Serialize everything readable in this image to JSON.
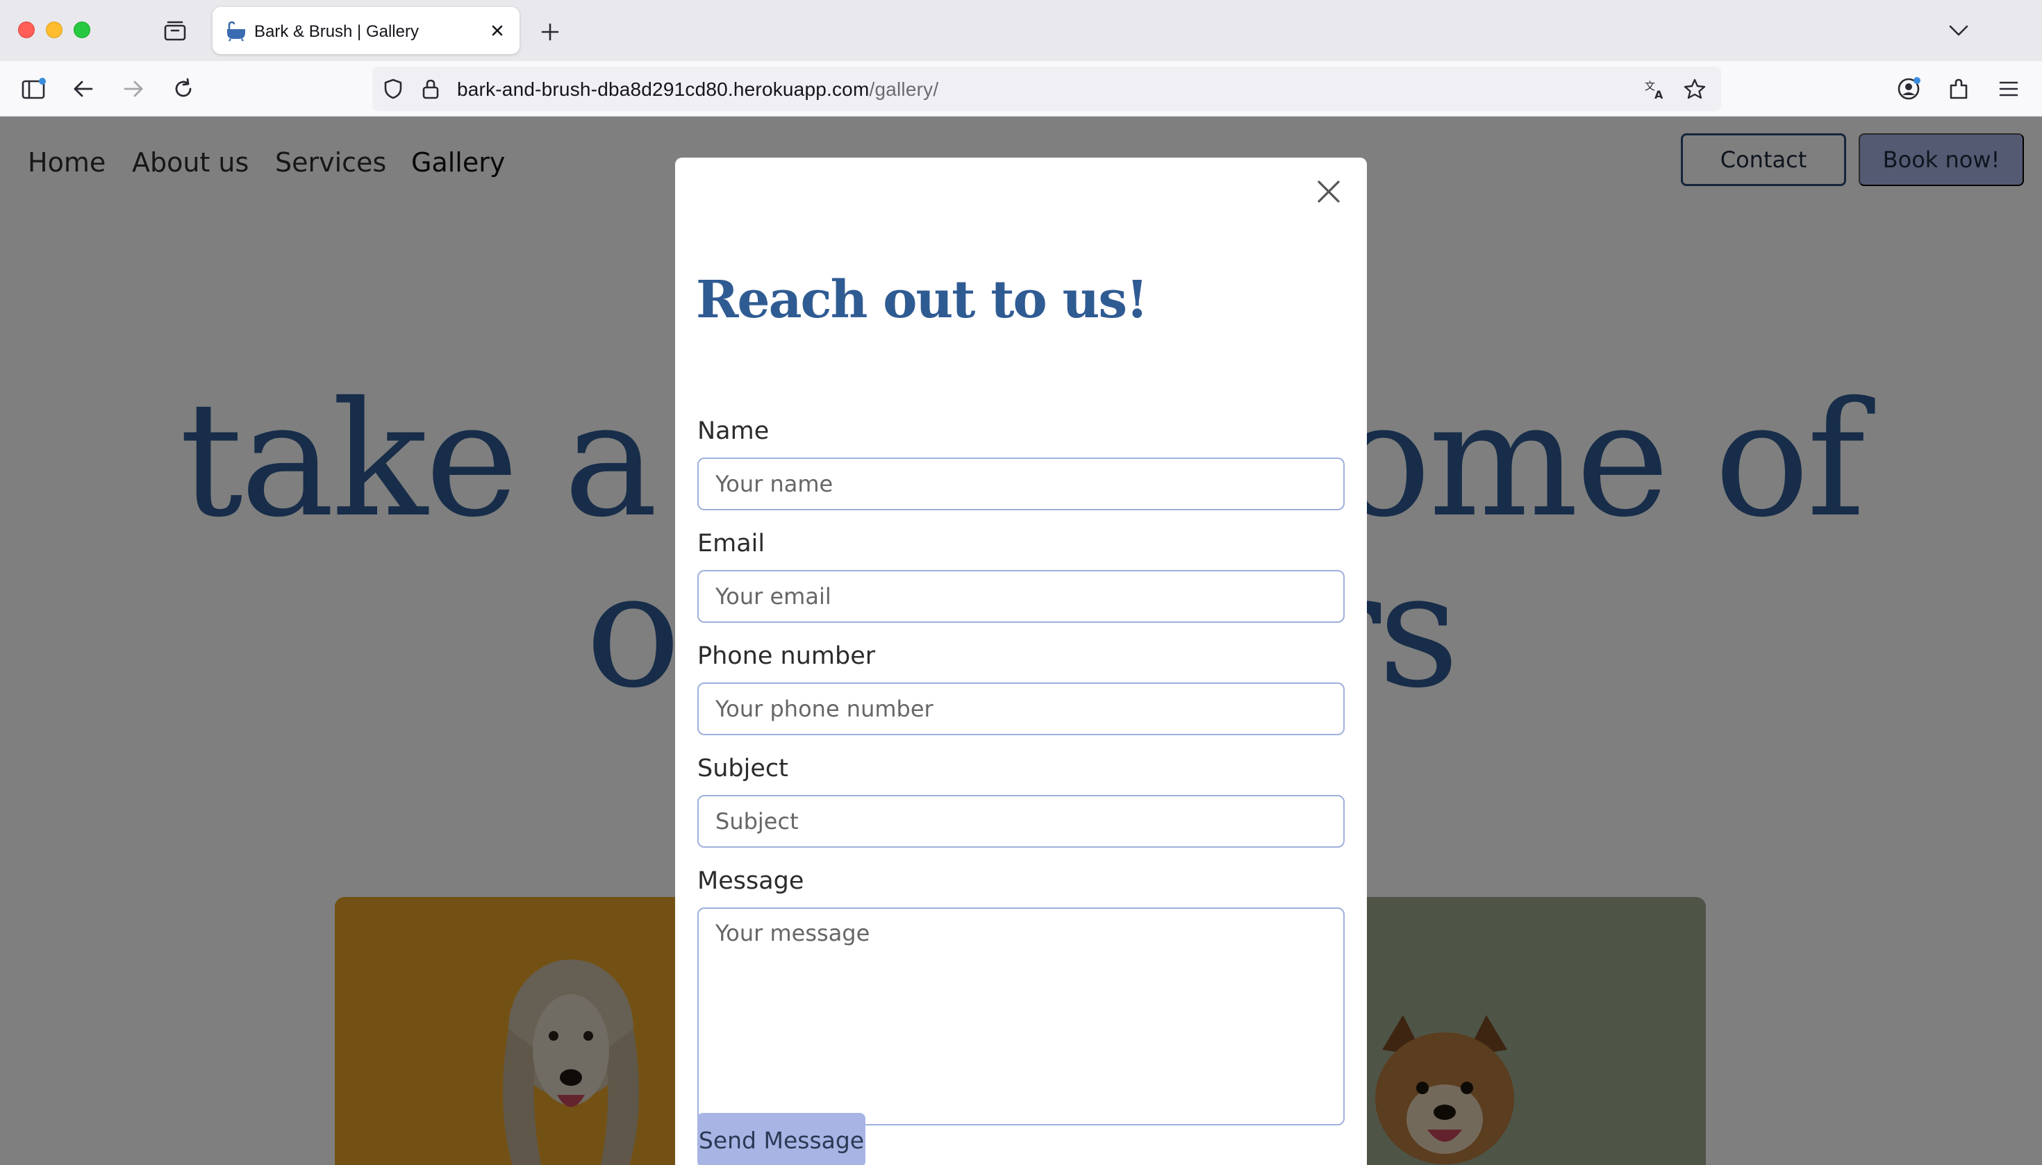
{
  "browser": {
    "tab_title": "Bark & Brush | Gallery",
    "url_host": "bark-and-brush-dba8d291cd80.herokuapp.com",
    "url_path": "/gallery/"
  },
  "site_nav": {
    "items": [
      "Home",
      "About us",
      "Services",
      "Gallery"
    ],
    "contact_label": "Contact",
    "book_label": "Book now!"
  },
  "hero": {
    "line1_left": "take a",
    "line1_right": "ome of",
    "line2_left": "ou",
    "line2_right": "rs"
  },
  "modal": {
    "title": "Reach out to us!",
    "fields": {
      "name": {
        "label": "Name",
        "placeholder": "Your name"
      },
      "email": {
        "label": "Email",
        "placeholder": "Your email"
      },
      "phone": {
        "label": "Phone number",
        "placeholder": "Your phone number"
      },
      "subject": {
        "label": "Subject",
        "placeholder": "Subject"
      },
      "message": {
        "label": "Message",
        "placeholder": "Your message"
      }
    },
    "submit_label": "Send Message"
  },
  "colors": {
    "accent_blue": "#2f5b93",
    "button_lavender": "#a8b4e4",
    "input_border": "#9fb0dc"
  },
  "icons": [
    "sidebar-icon",
    "back-icon",
    "forward-icon",
    "reload-icon",
    "shield-icon",
    "lock-icon",
    "translate-icon",
    "bookmark-star-icon",
    "account-icon",
    "extensions-icon",
    "menu-icon",
    "tab-list-icon",
    "new-tab-icon",
    "tab-overflow-icon",
    "close-icon"
  ]
}
